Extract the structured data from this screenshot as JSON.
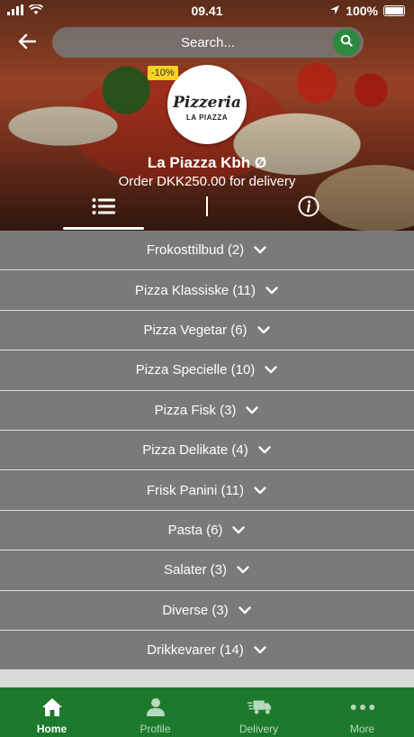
{
  "status_bar": {
    "time": "09.41",
    "battery": "100%"
  },
  "search": {
    "placeholder": "Search..."
  },
  "store": {
    "discount_badge": "-10%",
    "logo_line1": "Pizzeria",
    "logo_line2": "LA PIAZZA",
    "name": "La Piazza Kbh Ø",
    "order_info": "Order DKK250.00 for delivery"
  },
  "categories": [
    {
      "label": "Frokosttilbud (2)"
    },
    {
      "label": "Pizza Klassiske (11)"
    },
    {
      "label": "Pizza Vegetar (6)"
    },
    {
      "label": "Pizza Specielle (10)"
    },
    {
      "label": "Pizza Fisk (3)"
    },
    {
      "label": "Pizza Delikate (4)"
    },
    {
      "label": "Frisk Panini (11)"
    },
    {
      "label": "Pasta (6)"
    },
    {
      "label": "Salater (3)"
    },
    {
      "label": "Diverse (3)"
    },
    {
      "label": "Drikkevarer (14)"
    }
  ],
  "bottom_nav": [
    {
      "label": "Home",
      "icon": "home-icon"
    },
    {
      "label": "Profile",
      "icon": "user-icon"
    },
    {
      "label": "Delivery",
      "icon": "truck-icon"
    },
    {
      "label": "More",
      "icon": "more-icon"
    }
  ],
  "colors": {
    "accent": "#1d7a2c",
    "category_bg": "#7a7a7a",
    "discount": "#f7d21e"
  }
}
